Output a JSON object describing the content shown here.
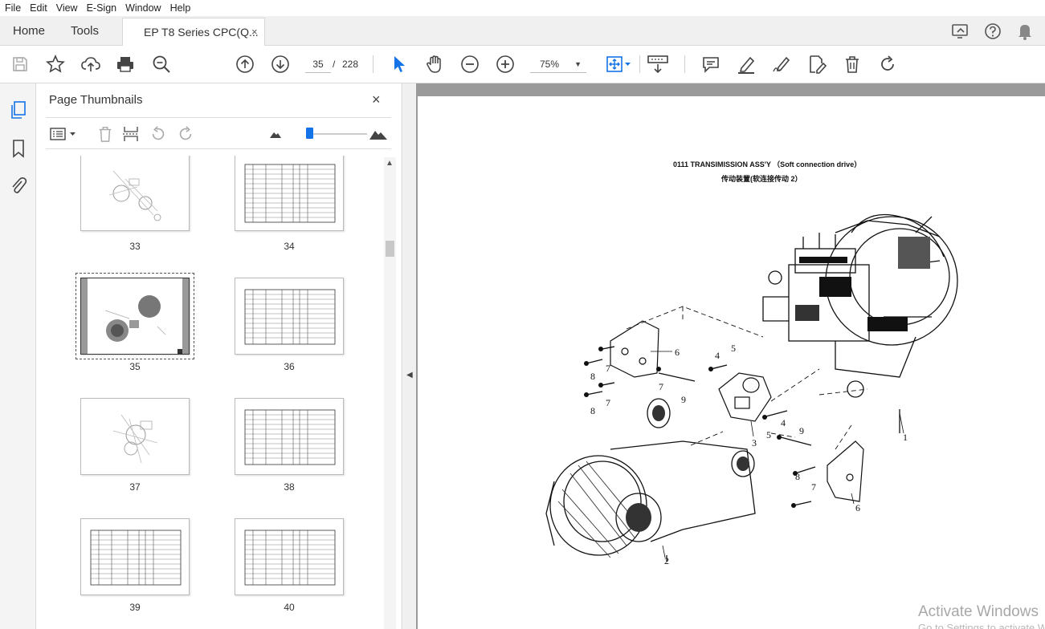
{
  "menu": [
    "File",
    "Edit",
    "View",
    "E-Sign",
    "Window",
    "Help"
  ],
  "tabs": {
    "home": "Home",
    "tools": "Tools",
    "document": "EP T8 Series CPC(Q...",
    "close": "×"
  },
  "toolbar": {
    "current_page": "35",
    "page_separator": "/",
    "total_pages": "228",
    "zoom": "75%"
  },
  "panel": {
    "title": "Page Thumbnails",
    "close": "×",
    "thumbnails": [
      {
        "label": "33",
        "kind": "diagram"
      },
      {
        "label": "34",
        "kind": "table"
      },
      {
        "label": "35",
        "kind": "diagram",
        "selected": true
      },
      {
        "label": "36",
        "kind": "table"
      },
      {
        "label": "37",
        "kind": "diagram"
      },
      {
        "label": "38",
        "kind": "table"
      },
      {
        "label": "39",
        "kind": "table"
      },
      {
        "label": "40",
        "kind": "table"
      }
    ]
  },
  "document": {
    "title": "0111 TRANSIMISSION ASS'Y （Soft connection drive）",
    "subtitle": "传动装置(软连接传动 2）",
    "callouts": [
      "1",
      "2",
      "3",
      "4",
      "4",
      "5",
      "5",
      "6",
      "6",
      "7",
      "7",
      "7",
      "7",
      "8",
      "8",
      "8",
      "9",
      "9"
    ]
  },
  "watermark": {
    "line1": "Activate Windows",
    "line2": "Go to Settings to activate Windows."
  },
  "colors": {
    "accent": "#1473e6",
    "doc_bg": "#9a9a9a"
  }
}
